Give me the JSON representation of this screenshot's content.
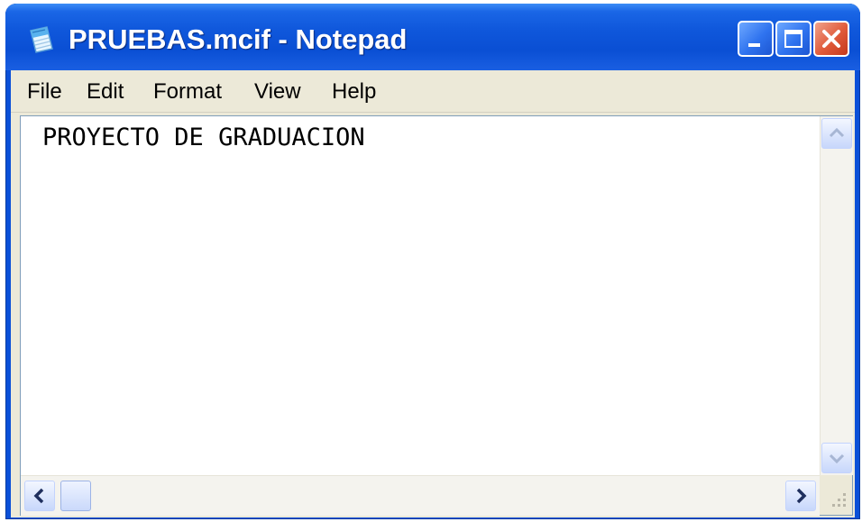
{
  "window": {
    "title": "PRUEBAS.mcif - Notepad",
    "icon": "notepad-icon",
    "title_color": "#0a4fd4"
  },
  "menu": {
    "items": [
      "File",
      "Edit",
      "Format",
      "View",
      "Help"
    ]
  },
  "editor": {
    "content": "PROYECTO DE GRADUACION"
  },
  "controls": {
    "minimize": "minimize-icon",
    "maximize": "maximize-icon",
    "close": "close-icon",
    "scroll_up": "chevron-up-icon",
    "scroll_down": "chevron-down-icon",
    "scroll_left": "chevron-left-icon",
    "scroll_right": "chevron-right-icon"
  }
}
